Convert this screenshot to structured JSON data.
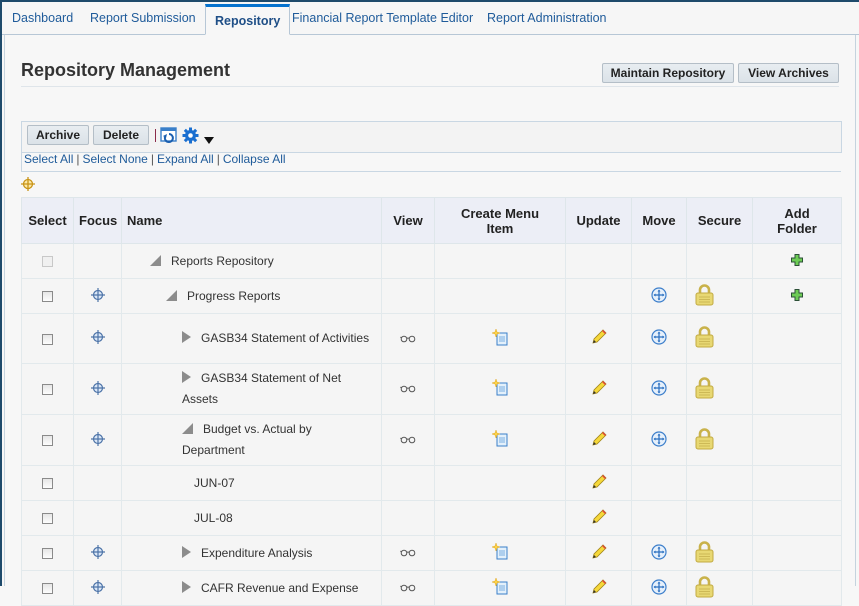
{
  "tabs": [
    {
      "label": "Dashboard",
      "active": false
    },
    {
      "label": "Report Submission",
      "active": false
    },
    {
      "label": "Repository",
      "active": true
    },
    {
      "label": "Financial Report Template Editor",
      "active": false
    },
    {
      "label": "Report Administration",
      "active": false
    }
  ],
  "page": {
    "title": "Repository Management",
    "maintain_repository_label": "Maintain Repository",
    "view_archives_label": "View Archives"
  },
  "toolbar": {
    "archive_label": "Archive",
    "delete_label": "Delete",
    "icons": [
      "detach-icon",
      "gear-icon",
      "dropdown-arrow-icon"
    ]
  },
  "links": {
    "select_all": "Select All",
    "select_none": "Select None",
    "expand_all": "Expand All",
    "collapse_all": "Collapse All",
    "separator": "|"
  },
  "table": {
    "headers": {
      "select": "Select",
      "focus": "Focus",
      "name": "Name",
      "view": "View",
      "create_menu_item": "Create Menu Item",
      "update": "Update",
      "move": "Move",
      "secure": "Secure",
      "add_folder": "Add Folder"
    },
    "rows": [
      {
        "name": "Reports Repository",
        "level": 0,
        "node": "expanded",
        "checkbox_disabled": true,
        "focus": false,
        "view": false,
        "create": false,
        "update": false,
        "move": false,
        "secure": false,
        "add_folder": true
      },
      {
        "name": "Progress Reports",
        "level": 1,
        "node": "expanded",
        "checkbox_disabled": false,
        "focus": true,
        "view": false,
        "create": false,
        "update": false,
        "move": true,
        "secure": true,
        "add_folder": true
      },
      {
        "name": "GASB34 Statement of Activities",
        "level": 2,
        "node": "collapsed",
        "checkbox_disabled": false,
        "focus": true,
        "view": true,
        "create": true,
        "update": true,
        "move": true,
        "secure": true,
        "add_folder": false
      },
      {
        "name": "GASB34 Statement of Net Assets",
        "level": 2,
        "node": "collapsed",
        "checkbox_disabled": false,
        "focus": true,
        "view": true,
        "create": true,
        "update": true,
        "move": true,
        "secure": true,
        "add_folder": false
      },
      {
        "name": "Budget vs. Actual by Department",
        "level": 2,
        "node": "expanded",
        "checkbox_disabled": false,
        "focus": true,
        "view": true,
        "create": true,
        "update": true,
        "move": true,
        "secure": true,
        "add_folder": false
      },
      {
        "name": "JUN-07",
        "level": 3,
        "node": "leaf",
        "checkbox_disabled": false,
        "focus": false,
        "view": false,
        "create": false,
        "update": true,
        "move": false,
        "secure": false,
        "add_folder": false
      },
      {
        "name": "JUL-08",
        "level": 3,
        "node": "leaf",
        "checkbox_disabled": false,
        "focus": false,
        "view": false,
        "create": false,
        "update": true,
        "move": false,
        "secure": false,
        "add_folder": false
      },
      {
        "name": "Expenditure Analysis",
        "level": 2,
        "node": "collapsed",
        "checkbox_disabled": false,
        "focus": true,
        "view": true,
        "create": true,
        "update": true,
        "move": true,
        "secure": true,
        "add_folder": false
      },
      {
        "name": "CAFR Revenue and Expense",
        "level": 2,
        "node": "collapsed",
        "checkbox_disabled": false,
        "focus": true,
        "view": true,
        "create": true,
        "update": true,
        "move": true,
        "secure": true,
        "add_folder": false
      }
    ]
  }
}
